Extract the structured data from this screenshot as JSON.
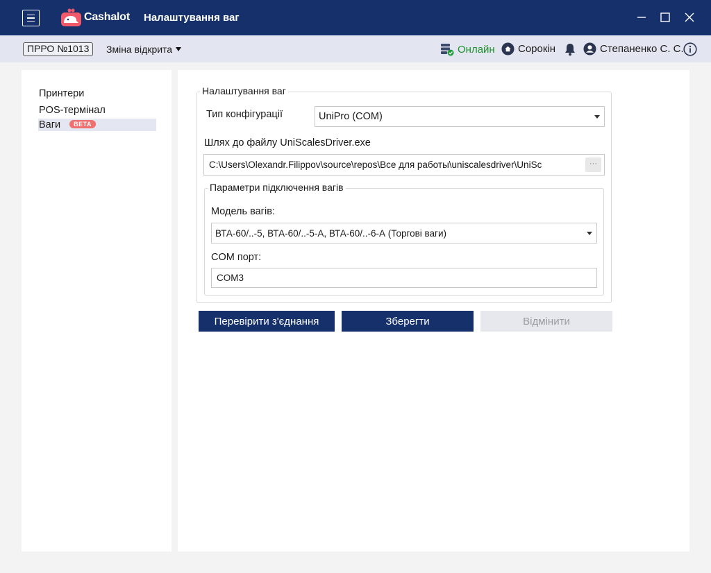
{
  "app": {
    "brand": "Cashalot",
    "title": "Налаштування ваг"
  },
  "statusbar": {
    "prro": "ПРРО №1013",
    "shift": "Зміна відкрита",
    "online": "Онлайн",
    "shop": "Сорокін",
    "user": "Степаненко С. С."
  },
  "sidebar": {
    "items": [
      {
        "label": "Принтери"
      },
      {
        "label": "POS-термінал"
      },
      {
        "label": "Ваги",
        "badge": "BETA"
      }
    ]
  },
  "form": {
    "group_title": "Налаштування ваг",
    "config_type_label": "Тип конфігурації",
    "config_type_value": "UniPro (COM)",
    "path_label": "Шлях до файлу UniScalesDriver.exe",
    "path_value": "C:\\Users\\Olexandr.Filippov\\source\\repos\\Все для работы\\uniscalesdriver\\UniSc",
    "browse_label": "···",
    "connection_group_title": "Параметри підключення вагів",
    "model_label": "Модель вагів:",
    "model_value": "ВТА-60/..-5, ВТА-60/..-5-А, ВТА-60/..-6-А (Торгові ваги)",
    "com_label": "COM порт:",
    "com_value": "COM3"
  },
  "buttons": {
    "check": "Перевірити з'єднання",
    "save": "Зберегти",
    "cancel": "Відмінити"
  },
  "colors": {
    "brand_navy": "#15306a",
    "online_green": "#1f8f2f",
    "beta_badge": "#f07070"
  }
}
